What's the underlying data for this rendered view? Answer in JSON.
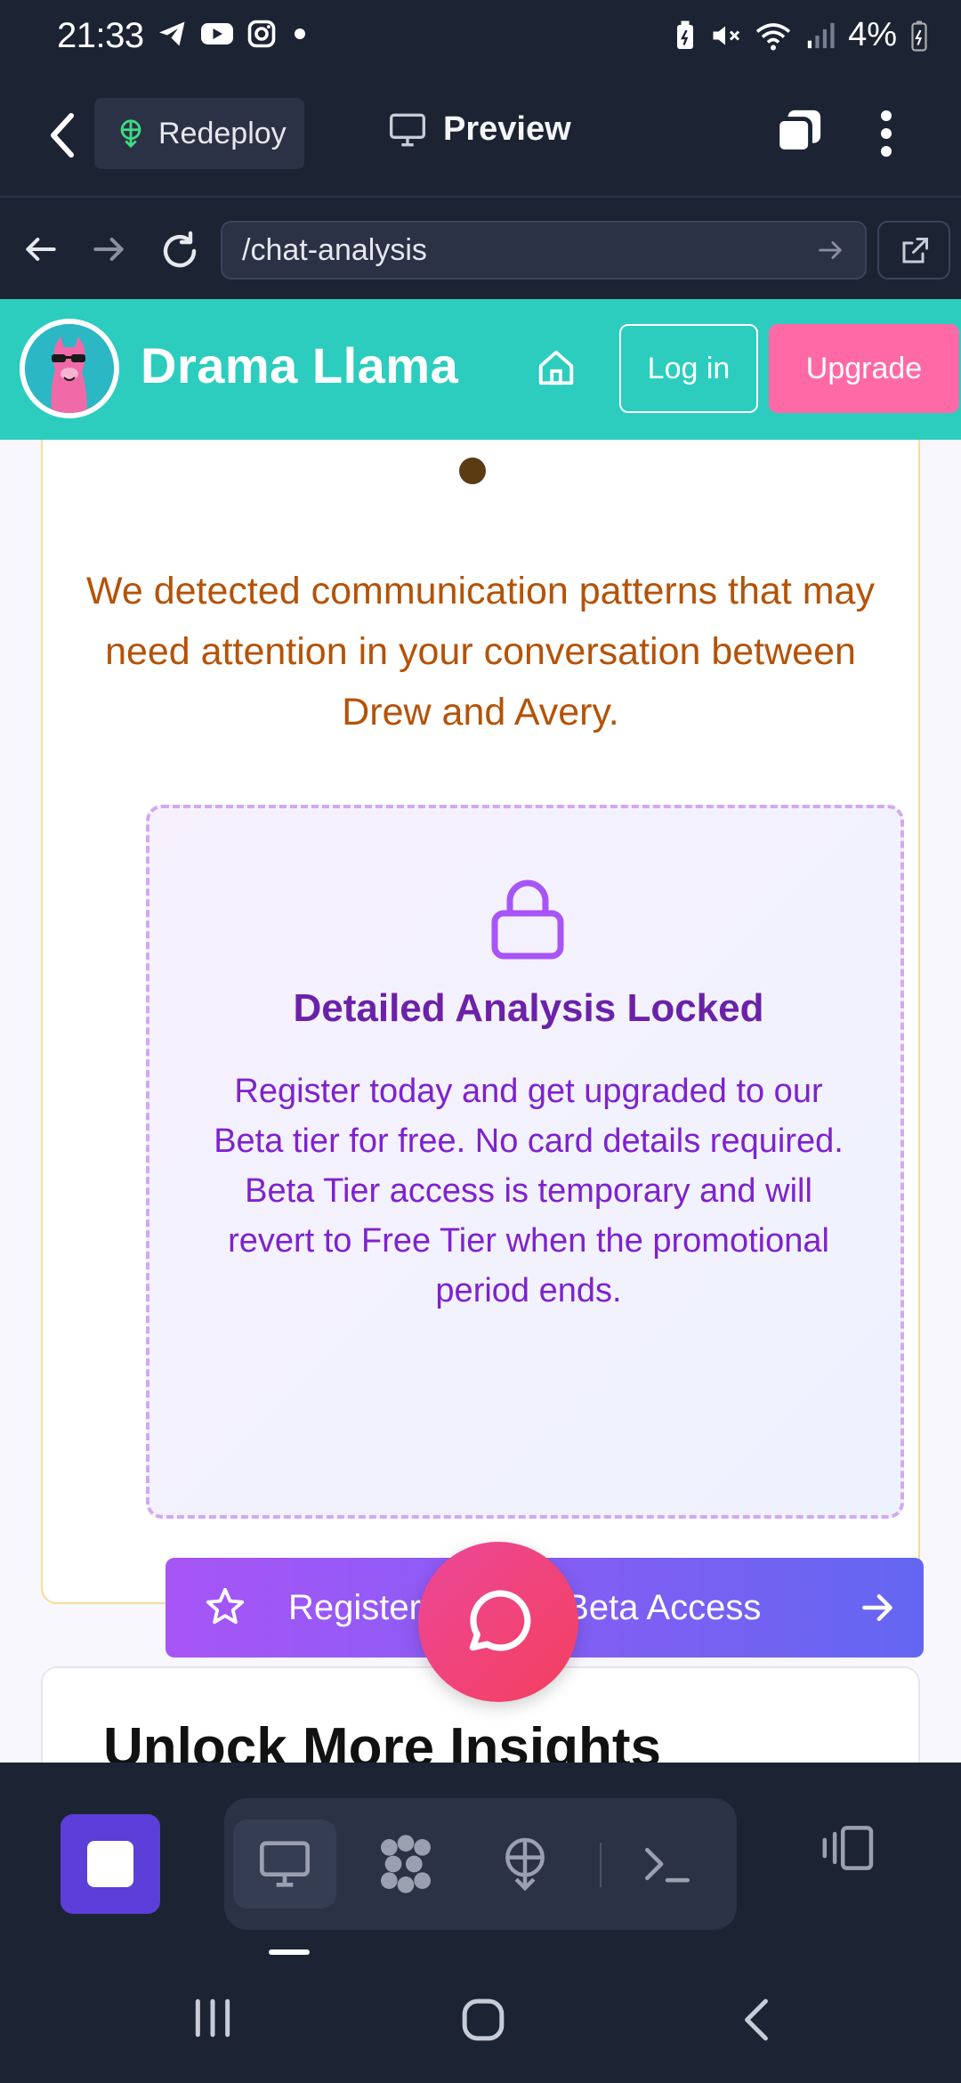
{
  "status_bar": {
    "time": "21:33",
    "battery": "4%",
    "left_icons": [
      "telegram-icon",
      "youtube-icon",
      "instagram-icon",
      "dot-icon"
    ],
    "right_icons": [
      "battery-saver-icon",
      "mute-icon",
      "wifi-icon",
      "signal-icon",
      "battery-icon"
    ]
  },
  "top_bar": {
    "redeploy_label": "Redeploy",
    "preview_label": "Preview"
  },
  "url_bar": {
    "url": "/chat-analysis"
  },
  "app_header": {
    "brand": "Drama Llama",
    "login_label": "Log in",
    "upgrade_label": "Upgrade"
  },
  "analysis_card": {
    "description": "We detected communication patterns that may need attention in your conversation between Drew and Avery."
  },
  "locked_box": {
    "title": "Detailed Analysis Locked",
    "text": "Register today and get upgraded to our Beta tier for free. No card details required. Beta Tier access is temporary and will revert to Free Tier when the promotional period ends.",
    "button_label": "Register for Free Beta Access"
  },
  "next_card": {
    "title": "Unlock More Insights"
  },
  "toolbar": {
    "tools": [
      "preview-tool",
      "workflows-tool",
      "deploy-tool",
      "shell-tool"
    ],
    "active_tool": "preview-tool"
  },
  "colors": {
    "header_teal": "#2ccdbe",
    "upgrade_pink": "#ff6aa6",
    "description_orange": "#b45309",
    "locked_purple": "#6b21a8",
    "button_gradient_start": "#a855f7",
    "button_gradient_end": "#6366f1",
    "stop_button": "#5b3fd8"
  }
}
